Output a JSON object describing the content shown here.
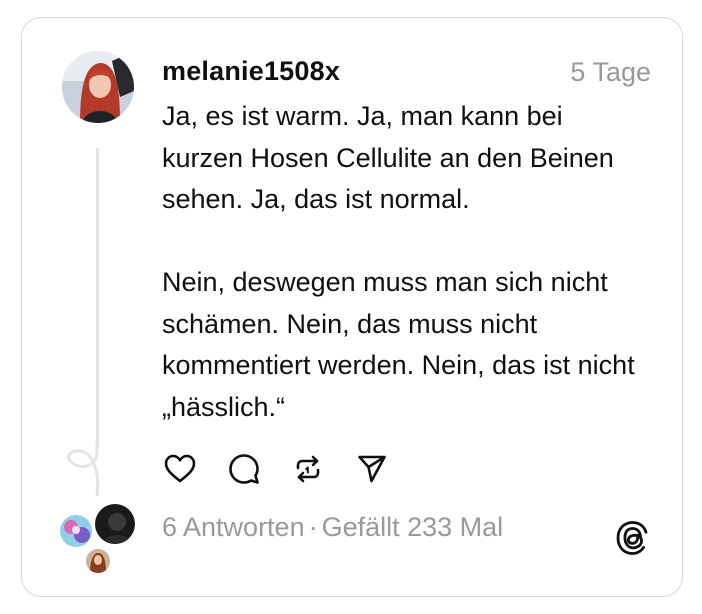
{
  "post": {
    "username": "melanie1508x",
    "time": "5 Tage",
    "paragraphs": [
      "Ja, es ist warm. Ja, man kann bei kurzen Hosen Cellulite an den Beinen sehen. Ja, das ist normal.",
      "Nein, deswegen muss man sich nicht schämen. Nein, das muss nicht kommentiert werden. Nein, das ist nicht „hässlich.“"
    ]
  },
  "stats": {
    "replies": "6 Antworten",
    "separator": "·",
    "likes": "Gefällt 233 Mal"
  },
  "actions": [
    "heart-icon",
    "comment-icon",
    "repost-icon",
    "share-icon"
  ],
  "colors": {
    "text": "#101010",
    "muted": "#999999",
    "border": "#d8d8d8"
  }
}
